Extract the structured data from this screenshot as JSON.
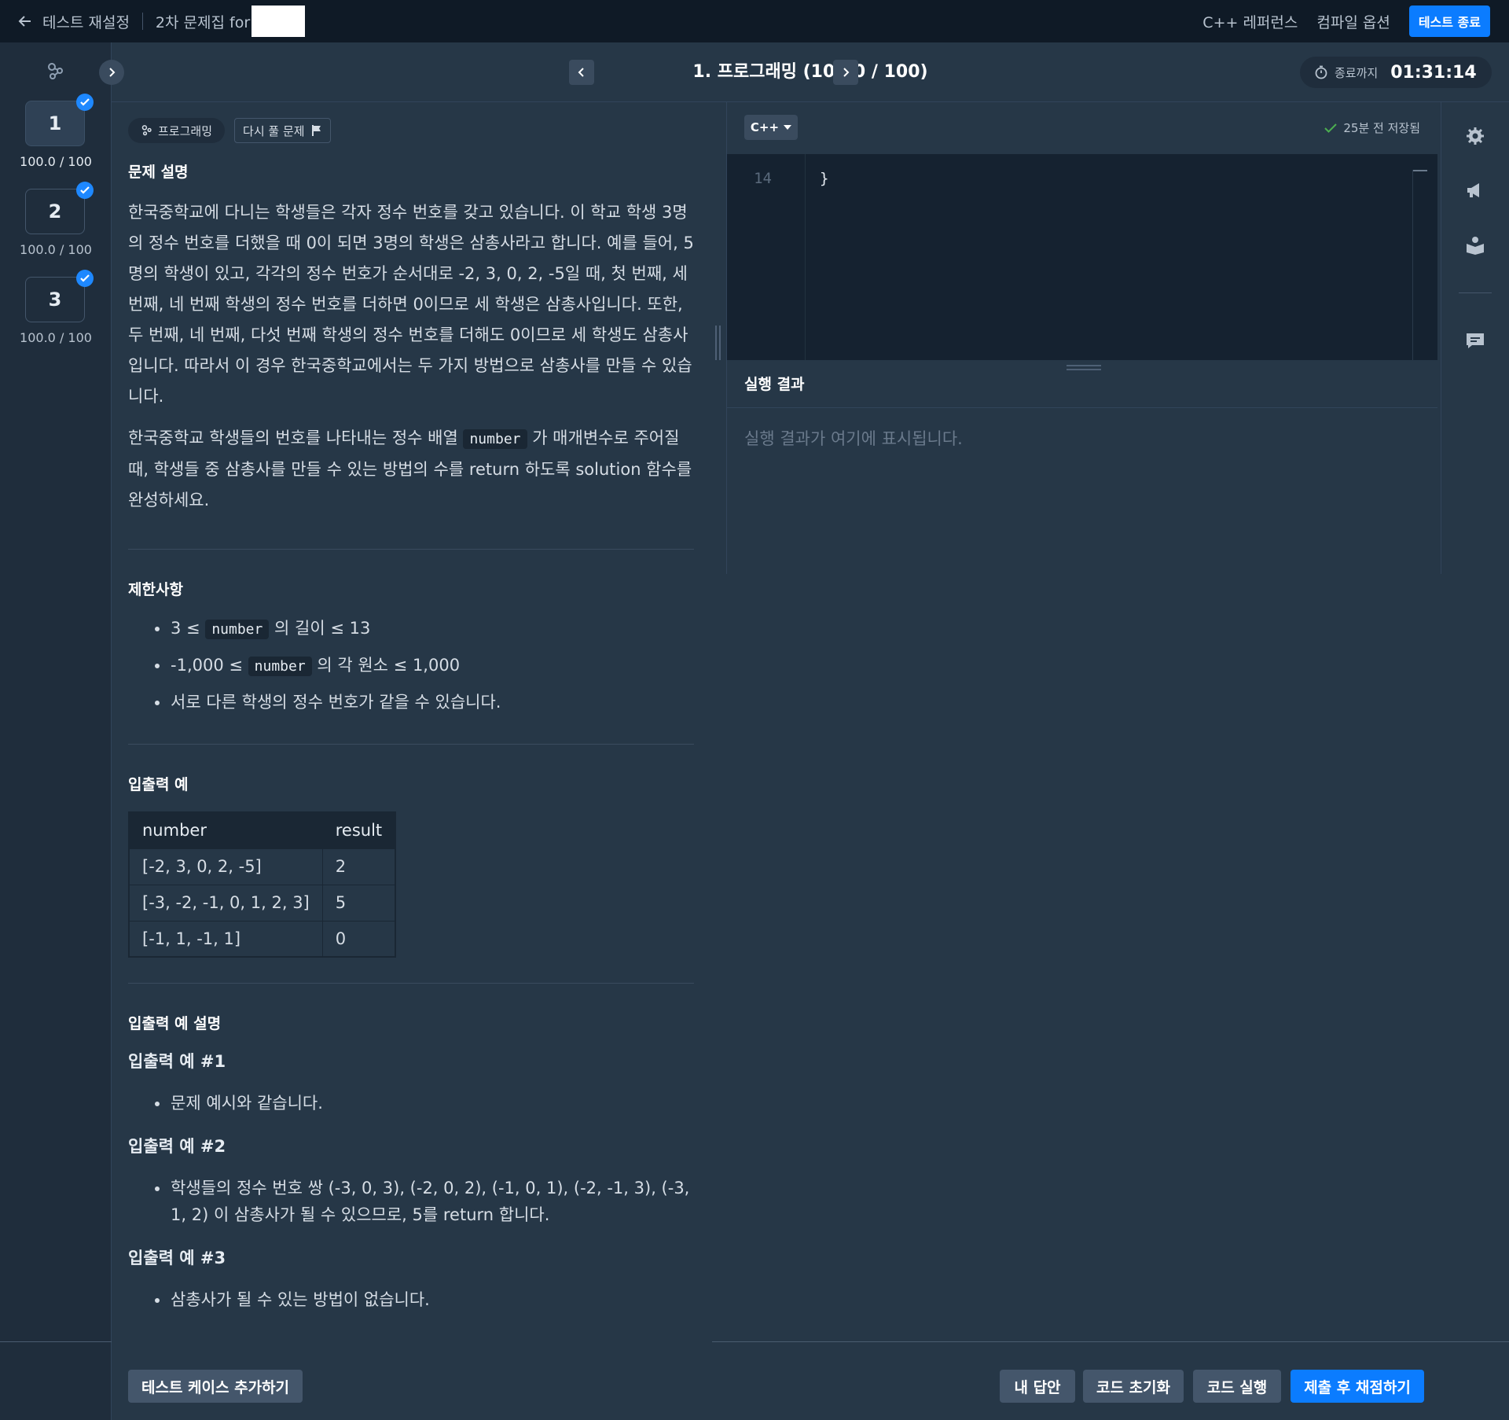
{
  "topbar": {
    "back_label": "테스트 재설정",
    "crumb": "2차 문제집 for",
    "reference": "C++ 레퍼런스",
    "compile_options": "컴파일 옵션",
    "end_test": "테스트 종료"
  },
  "rail": {
    "questions": [
      {
        "number": "1",
        "score": "100.0 / 100",
        "active": true,
        "done": true
      },
      {
        "number": "2",
        "score": "100.0 / 100",
        "active": false,
        "done": true
      },
      {
        "number": "3",
        "score": "100.0 / 100",
        "active": false,
        "done": true
      }
    ]
  },
  "header": {
    "title": "1. 프로그래밍 (100.0 / 100)",
    "timer_label": "종료까지",
    "timer_value": "01:31:14"
  },
  "description": {
    "tag_category": "프로그래밍",
    "tag_retry": "다시 풀 문제",
    "section_title": "문제 설명",
    "para1": "한국중학교에 다니는 학생들은 각자 정수 번호를 갖고 있습니다. 이 학교 학생 3명의 정수 번호를 더했을 때 0이 되면 3명의 학생은 삼총사라고 합니다. 예를 들어, 5명의 학생이 있고, 각각의 정수 번호가 순서대로 -2, 3, 0, 2, -5일 때, 첫 번째, 세 번째, 네 번째 학생의 정수 번호를 더하면 0이므로 세 학생은 삼총사입니다. 또한, 두 번째, 네 번째, 다섯 번째 학생의 정수 번호를 더해도 0이므로 세 학생도 삼총사입니다. 따라서 이 경우 한국중학교에서는 두 가지 방법으로 삼총사를 만들 수 있습니다.",
    "para2_a": "한국중학교 학생들의 번호를 나타내는 정수 배열",
    "para2_code": "number",
    "para2_b": "가 매개변수로 주어질 때, 학생들 중 삼총사를 만들 수 있는 방법의 수를 return 하도록 solution 함수를 완성하세요.",
    "constraints_title": "제한사항",
    "c1_a": "3 ≤",
    "c1_code": "number",
    "c1_b": "의 길이 ≤ 13",
    "c2_a": "-1,000 ≤",
    "c2_code": "number",
    "c2_b": "의 각 원소 ≤ 1,000",
    "c3": "서로 다른 학생의 정수 번호가 같을 수 있습니다.",
    "io_title": "입출력 예",
    "io_headers": [
      "number",
      "result"
    ],
    "io_rows": [
      [
        "[-2, 3, 0, 2, -5]",
        "2"
      ],
      [
        "[-3, -2, -1, 0, 1, 2, 3]",
        "5"
      ],
      [
        "[-1, 1, -1, 1]",
        "0"
      ]
    ],
    "io_desc_title": "입출력 예 설명",
    "ex1_title": "입출력 예 #1",
    "ex1_item": "문제 예시와 같습니다.",
    "ex2_title": "입출력 예 #2",
    "ex2_item": "학생들의 정수 번호 쌍 (-3, 0, 3), (-2, 0, 2), (-1, 0, 1), (-2, -1, 3), (-3, 1, 2) 이 삼총사가 될 수 있으므로, 5를 return 합니다.",
    "ex3_title": "입출력 예 #3",
    "ex3_item": "삼총사가 될 수 있는 방법이 없습니다."
  },
  "editor": {
    "language": "C++",
    "saved": "25분 전 저장됨",
    "line_number": "14",
    "line_code": "}",
    "result_title": "실행 결과",
    "result_placeholder": "실행 결과가 여기에 표시됩니다."
  },
  "bottom": {
    "add_testcase": "테스트 케이스 추가하기",
    "my_answer": "내 답안",
    "reset_code": "코드 초기화",
    "run_code": "코드 실행",
    "submit": "제출 후 채점하기"
  },
  "colors": {
    "accent": "#0b7cff",
    "bg": "#263747",
    "topbar": "#0f1a26"
  },
  "icons": [
    "arrow-left-icon",
    "programming-icon",
    "chevron-right-icon",
    "chevron-left-icon",
    "stopwatch-icon",
    "check-icon",
    "flag-icon",
    "caret-down-icon",
    "gear-icon",
    "megaphone-icon",
    "reader-icon",
    "chat-icon"
  ]
}
